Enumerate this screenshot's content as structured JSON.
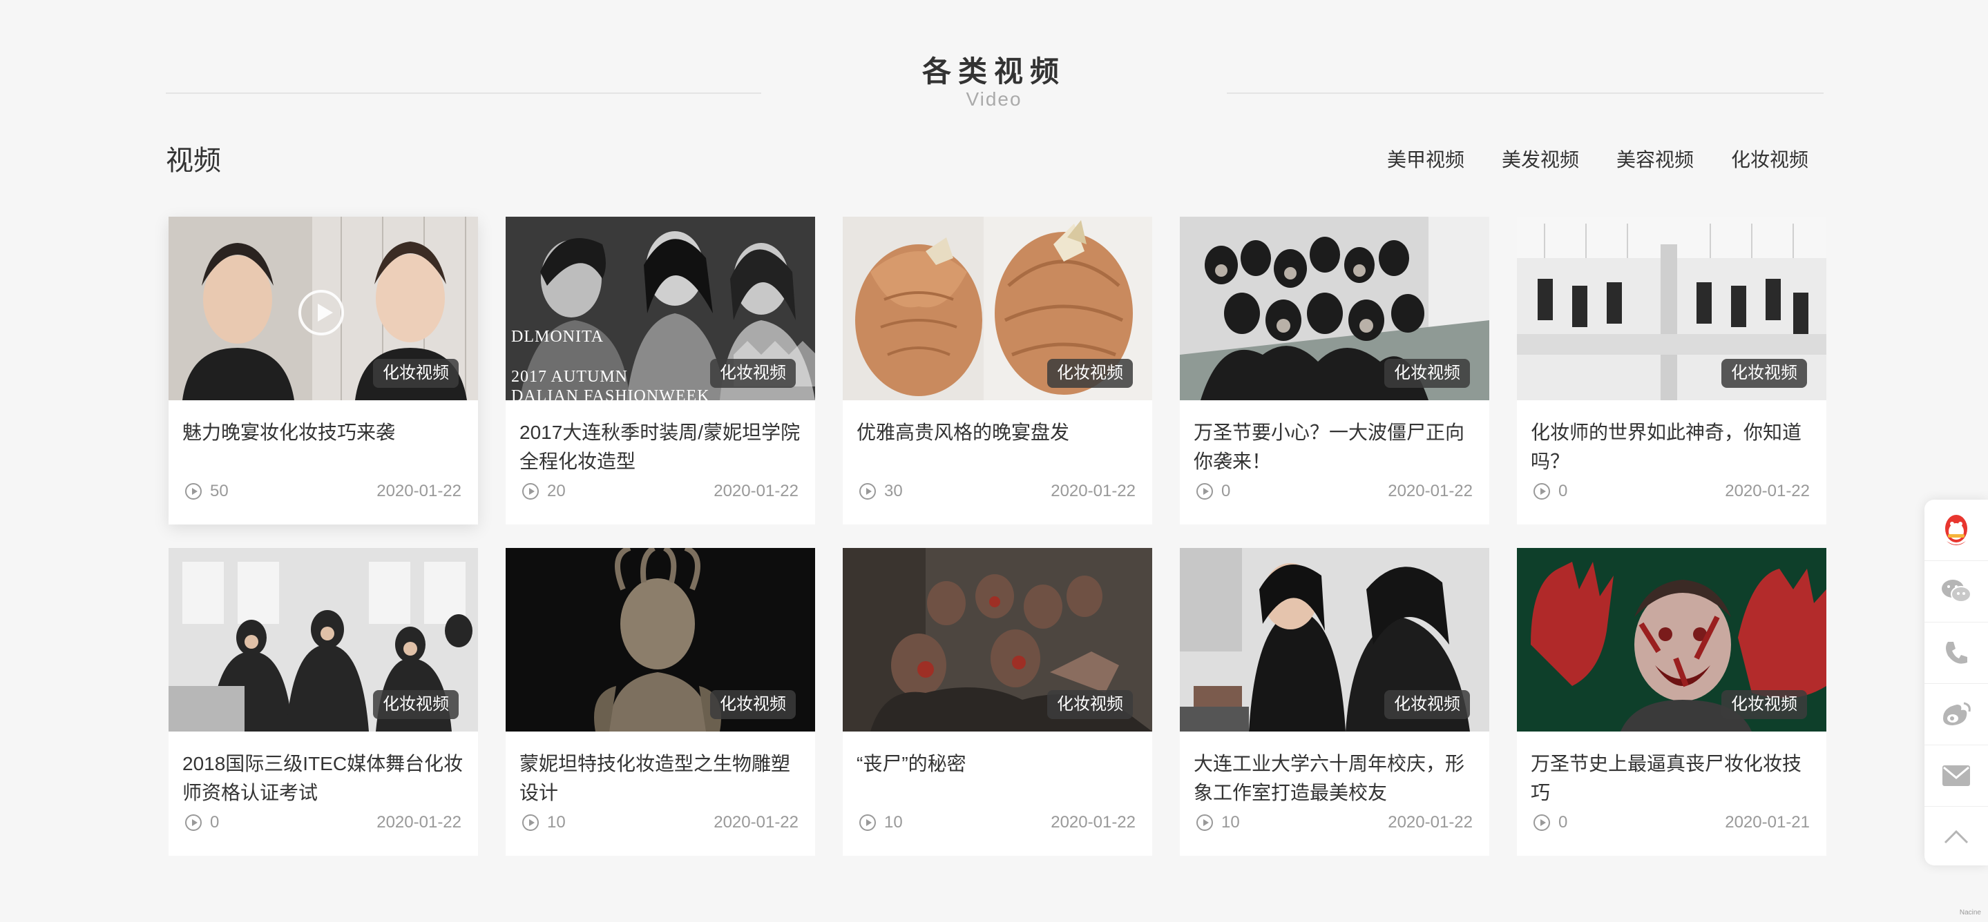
{
  "section": {
    "title": "各类视频",
    "subtitle": "Video"
  },
  "bar": {
    "title": "视频",
    "categories": [
      "美甲视频",
      "美发视频",
      "美容视频",
      "化妆视频"
    ]
  },
  "videos": [
    {
      "title": "魅力晚宴妆化妆技巧来袭",
      "views": "50",
      "date": "2020-01-22",
      "tag": "化妆视频"
    },
    {
      "title": "2017大连秋季时装周/蒙妮坦学院全程化妆造型",
      "views": "20",
      "date": "2020-01-22",
      "tag": "化妆视频",
      "overlay_text": [
        "DLMONITA",
        "2017 AUTUMN",
        "DALIAN FASHIONWEEK"
      ]
    },
    {
      "title": "优雅高贵风格的晚宴盘发",
      "views": "30",
      "date": "2020-01-22",
      "tag": "化妆视频"
    },
    {
      "title": "万圣节要小心？一大波僵尸正向你袭来！",
      "views": "0",
      "date": "2020-01-22",
      "tag": "化妆视频"
    },
    {
      "title": "化妆师的世界如此神奇，你知道吗？",
      "views": "0",
      "date": "2020-01-22",
      "tag": "化妆视频"
    },
    {
      "title": "2018国际三级ITEC媒体舞台化妆师资格认证考试",
      "views": "0",
      "date": "2020-01-22",
      "tag": "化妆视频"
    },
    {
      "title": "蒙妮坦特技化妆造型之生物雕塑设计",
      "views": "10",
      "date": "2020-01-22",
      "tag": "化妆视频"
    },
    {
      "title": "“丧尸”的秘密",
      "views": "10",
      "date": "2020-01-22",
      "tag": "化妆视频"
    },
    {
      "title": "大连工业大学六十周年校庆，形象工作室打造最美校友",
      "views": "10",
      "date": "2020-01-22",
      "tag": "化妆视频"
    },
    {
      "title": "万圣节史上最逼真丧尸妆化妆技巧",
      "views": "0",
      "date": "2020-01-21",
      "tag": "化妆视频"
    }
  ],
  "sidebar": [
    "qq-icon",
    "wechat-icon",
    "phone-icon",
    "weibo-icon",
    "mail-icon",
    "chevron-up-icon"
  ],
  "colors": {
    "accent_qq": "#e8362f",
    "icon_gray": "#b5b5b5",
    "background": "#f6f6f6"
  },
  "corner": {
    "text": "Nacine"
  }
}
